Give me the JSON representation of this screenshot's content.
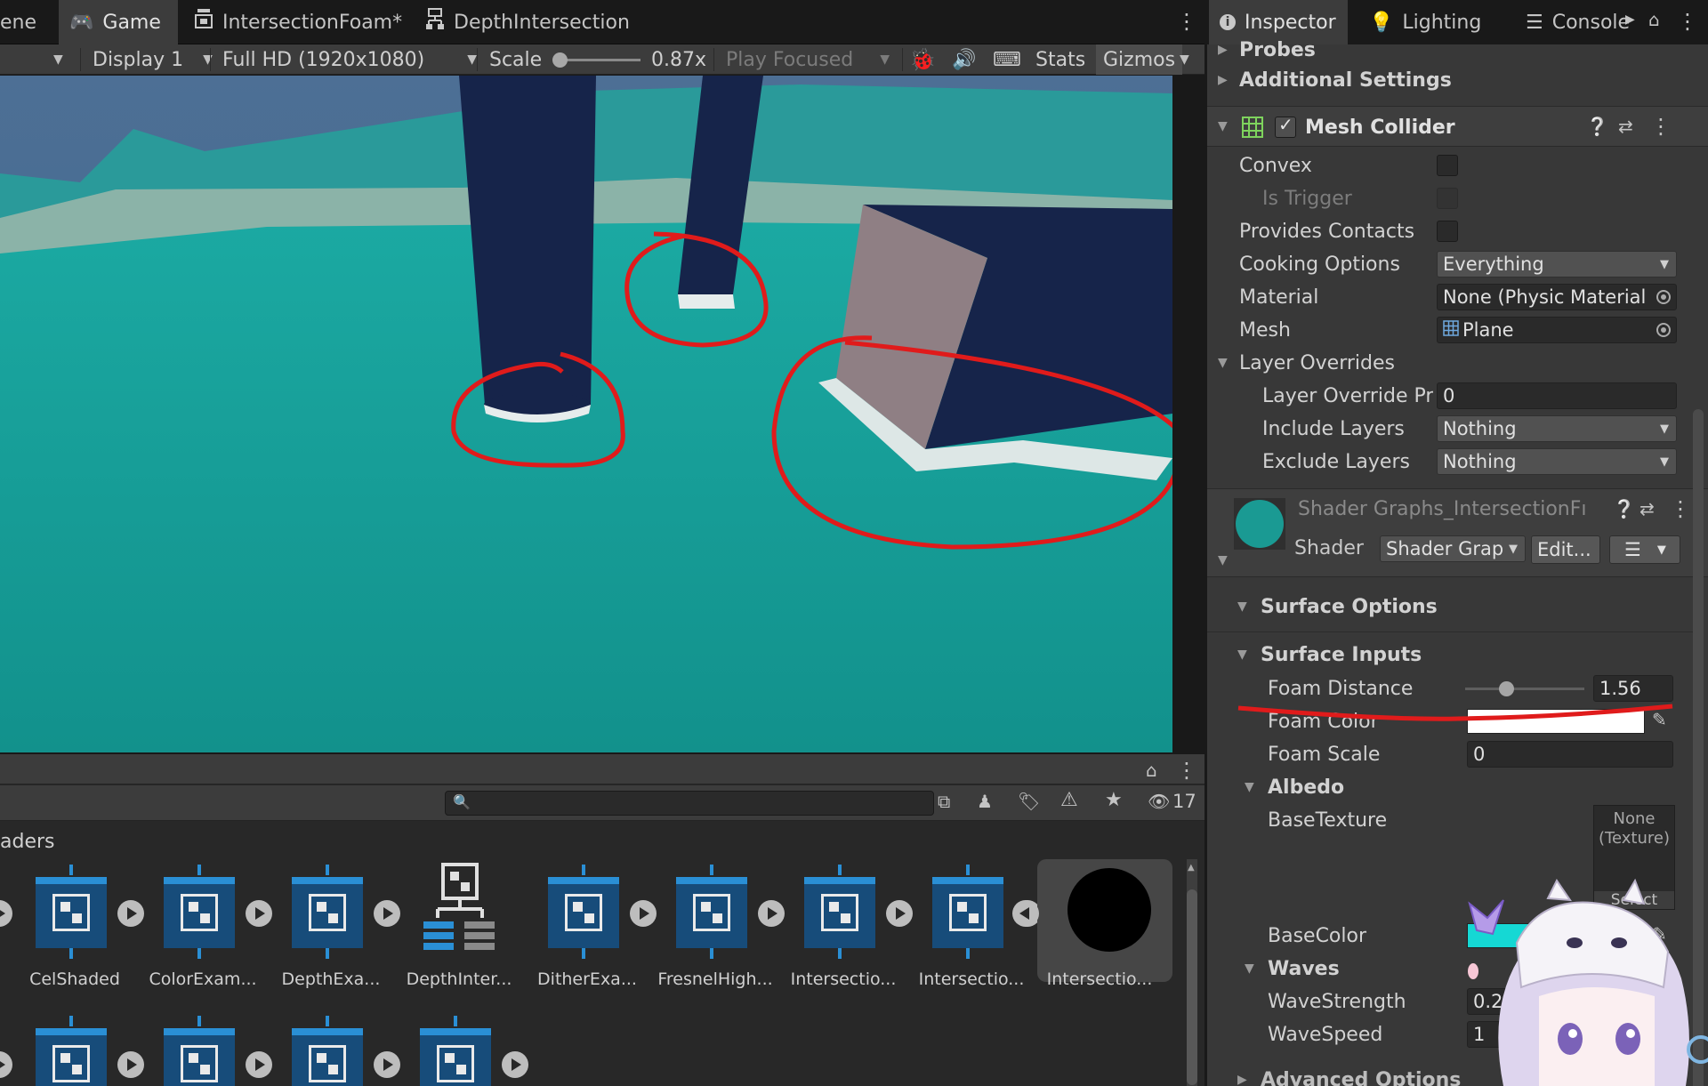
{
  "tabs": [
    {
      "label": "ene",
      "active": false
    },
    {
      "label": "Game",
      "active": true
    },
    {
      "label": "IntersectionFoam*",
      "active": false
    },
    {
      "label": "DepthIntersection",
      "active": false
    }
  ],
  "game_toolbar": {
    "display": "Display 1",
    "resolution": "Full HD (1920x1080)",
    "scale_label": "Scale",
    "scale_value": "0.87x",
    "scale_fraction": 0.05,
    "play_mode": "Play Focused",
    "stats": "Stats",
    "gizmos": "Gizmos"
  },
  "project": {
    "search_placeholder": "",
    "hidden_count": "17",
    "breadcrumb": "aders",
    "assets_row1": [
      "CelShaded",
      "ColorExam...",
      "DepthExa...",
      "DepthInter...",
      "DitherExa...",
      "FresnelHigh...",
      "Intersectio...",
      "Intersectio...",
      "Intersectio..."
    ]
  },
  "inspector": {
    "tabs": [
      {
        "label": "Inspector",
        "active": true
      },
      {
        "label": "Lighting",
        "active": false
      },
      {
        "label": "Console",
        "active": false
      }
    ],
    "probes": "Probes",
    "additional_settings": "Additional Settings",
    "mesh_collider": {
      "title": "Mesh Collider",
      "enabled": true,
      "convex_label": "Convex",
      "is_trigger_label": "Is Trigger",
      "provides_contacts_label": "Provides Contacts",
      "cooking_options_label": "Cooking Options",
      "cooking_options_value": "Everything",
      "material_label": "Material",
      "material_value": "None (Physic Material",
      "mesh_label": "Mesh",
      "mesh_value": "Plane",
      "layer_overrides_label": "Layer Overrides",
      "layer_override_priority_label": "Layer Override Pric",
      "layer_override_priority_value": "0",
      "include_layers_label": "Include Layers",
      "include_layers_value": "Nothing",
      "exclude_layers_label": "Exclude Layers",
      "exclude_layers_value": "Nothing"
    },
    "material": {
      "title": "Shader Graphs_IntersectionFı",
      "shader_label": "Shader",
      "shader_value": "Shader Grap",
      "edit_label": "Edit..."
    },
    "surface_options": "Surface Options",
    "surface_inputs": "Surface Inputs",
    "foam_distance_label": "Foam Distance",
    "foam_distance_value": "1.56",
    "foam_distance_fraction": 0.34,
    "foam_color_label": "Foam Color",
    "foam_scale_label": "Foam Scale",
    "foam_scale_value": "0",
    "albedo_label": "Albedo",
    "base_texture_label": "BaseTexture",
    "texture_none_line1": "None",
    "texture_none_line2": "(Texture)",
    "texture_select": "Select",
    "base_color_label": "BaseColor",
    "waves_label": "Waves",
    "wave_strength_label": "WaveStrength",
    "wave_strength_value": "0.2",
    "wave_speed_label": "WaveSpeed",
    "wave_speed_value": "1",
    "advanced_options": "Advanced Options"
  },
  "colors": {
    "water": "#1a9a93",
    "pillar": "#16244a",
    "foam": "#e6ecec",
    "annotation": "#e01b1b",
    "base_color": "#15d8d4"
  }
}
